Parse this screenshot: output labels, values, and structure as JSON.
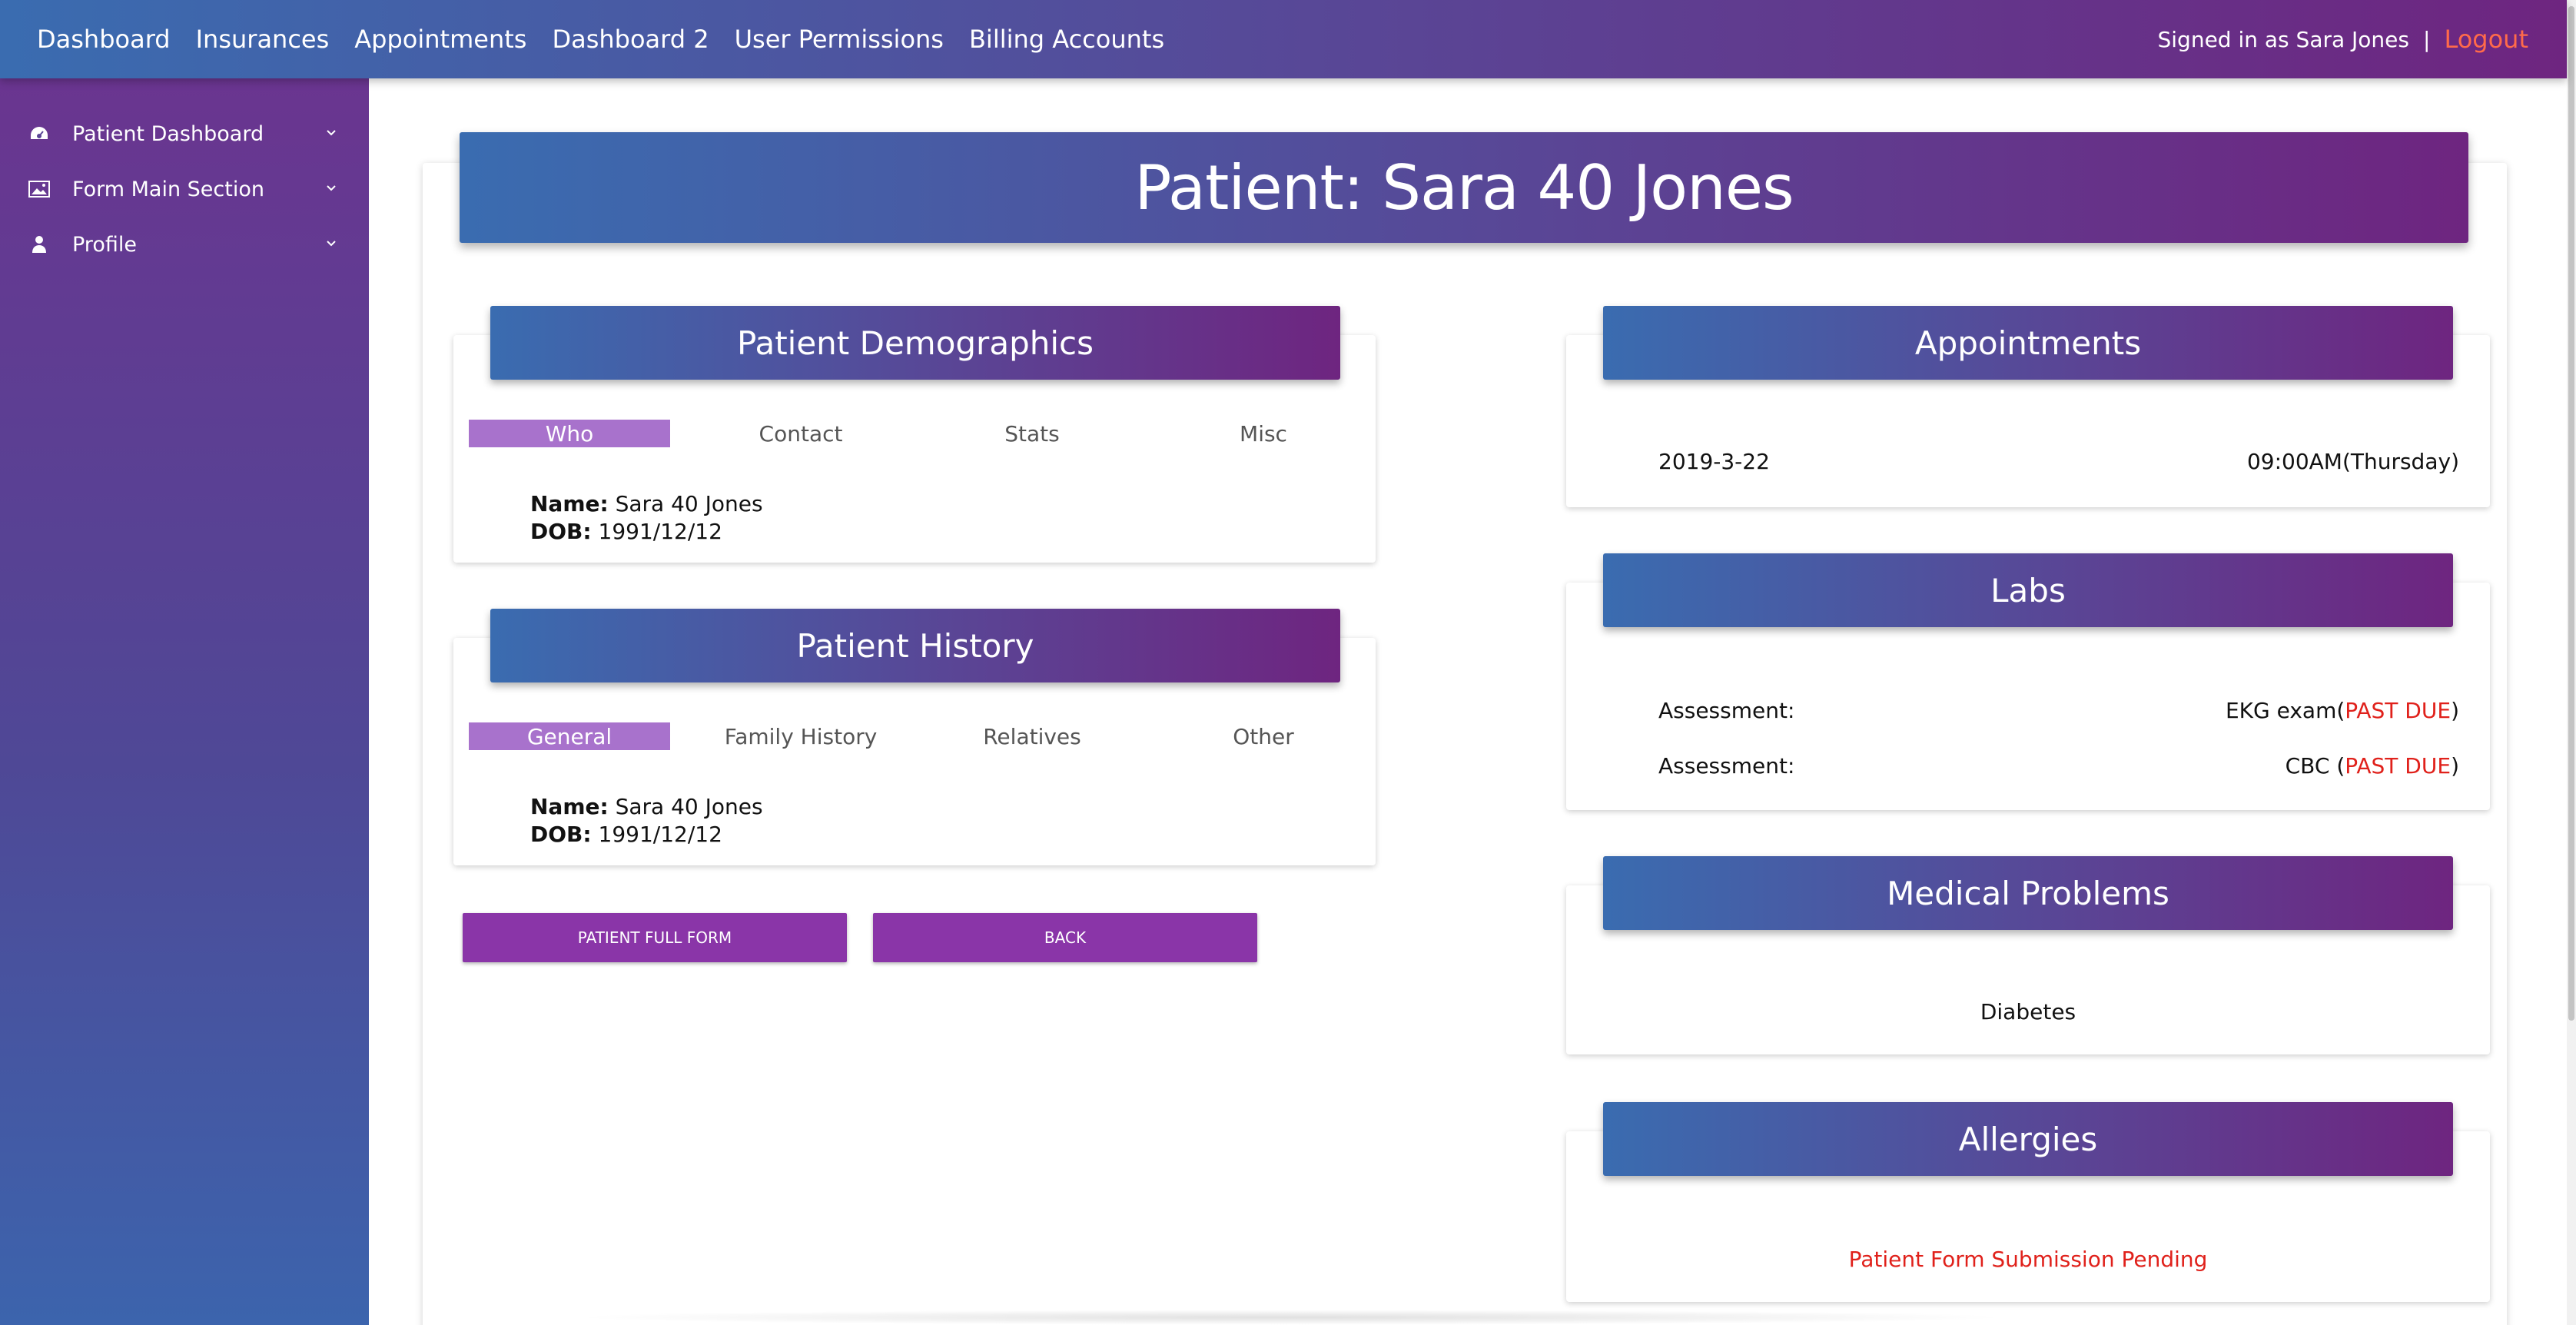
{
  "nav": {
    "links": [
      "Dashboard",
      "Insurances",
      "Appointments",
      "Dashboard 2",
      "User Permissions",
      "Billing Accounts"
    ],
    "signed_in": "Signed in as Sara Jones",
    "separator": "|",
    "logout": "Logout"
  },
  "sidebar": {
    "items": [
      {
        "label": "Patient Dashboard",
        "icon": "dashboard-gauge-icon"
      },
      {
        "label": "Form Main Section",
        "icon": "image-icon"
      },
      {
        "label": "Profile",
        "icon": "user-icon"
      }
    ]
  },
  "page": {
    "title": "Patient: Sara 40 Jones"
  },
  "demographics": {
    "title": "Patient Demographics",
    "tabs": [
      "Who",
      "Contact",
      "Stats",
      "Misc"
    ],
    "active_tab": "Who",
    "name_label": "Name:",
    "name_value": "Sara 40 Jones",
    "dob_label": "DOB:",
    "dob_value": "1991/12/12"
  },
  "history": {
    "title": "Patient History",
    "tabs": [
      "General",
      "Family History",
      "Relatives",
      "Other"
    ],
    "active_tab": "General",
    "name_label": "Name:",
    "name_value": "Sara 40 Jones",
    "dob_label": "DOB:",
    "dob_value": "1991/12/12"
  },
  "buttons": {
    "full_form": "PATIENT FULL FORM",
    "back": "BACK"
  },
  "appointments": {
    "title": "Appointments",
    "date": "2019-3-22",
    "time": "09:00AM(Thursday)"
  },
  "labs": {
    "title": "Labs",
    "rows": [
      {
        "label": "Assessment:",
        "test": "EKG exam(",
        "status": "PAST DUE",
        "close": ")"
      },
      {
        "label": "Assessment:",
        "test": "CBC (",
        "status": "PAST DUE",
        "close": ")"
      }
    ]
  },
  "medical_problems": {
    "title": "Medical Problems",
    "items": [
      "Diabetes"
    ]
  },
  "allergies": {
    "title": "Allergies",
    "status": "Patient Form Submission Pending"
  },
  "colors": {
    "status_red": "#e0211b",
    "button_purple": "#8a35a8",
    "tab_active": "#a872cc",
    "logout": "#ff6a4a"
  }
}
